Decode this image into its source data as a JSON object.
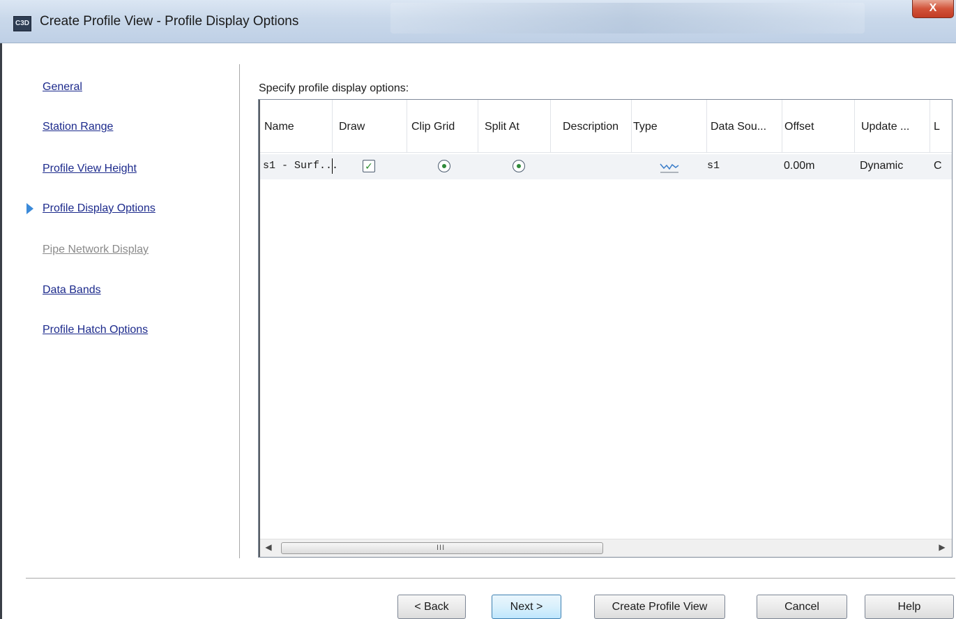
{
  "window": {
    "title": "Create Profile View - Profile Display Options",
    "close_label": "X",
    "icon_text": "C3D"
  },
  "nav": {
    "items": [
      {
        "label": "General",
        "disabled": false
      },
      {
        "label": "Station Range",
        "disabled": false
      },
      {
        "label": "Profile View Height",
        "disabled": false
      },
      {
        "label": "Profile Display Options",
        "disabled": false,
        "current": true
      },
      {
        "label": "Pipe Network Display",
        "disabled": true
      },
      {
        "label": "Data Bands",
        "disabled": false
      },
      {
        "label": "Profile Hatch Options",
        "disabled": false
      }
    ]
  },
  "main": {
    "section_label": "Specify profile display options:",
    "table": {
      "columns": [
        "Name",
        "Draw",
        "Clip Grid",
        "Split At",
        "Description",
        "Type",
        "Data Sou...",
        "Offset",
        "Update ...",
        "L"
      ],
      "rows": [
        {
          "name": "s1 - Surf...",
          "draw": true,
          "clip_grid": true,
          "split_at": true,
          "description": "",
          "type_icon": "surface-profile-icon",
          "data_source": "s1",
          "offset": "0.00m",
          "update": "Dynamic",
          "last": "C"
        }
      ]
    },
    "scrollbar": {
      "grip": "III"
    }
  },
  "buttons": {
    "back": "< Back",
    "next": "Next >",
    "create": "Create Profile View",
    "cancel": "Cancel",
    "help": "Help"
  },
  "colors": {
    "link": "#1c2a8c",
    "disabled": "#8a8a8a",
    "current_arrow": "#3b8ad9",
    "close_button": "#c23c24"
  }
}
